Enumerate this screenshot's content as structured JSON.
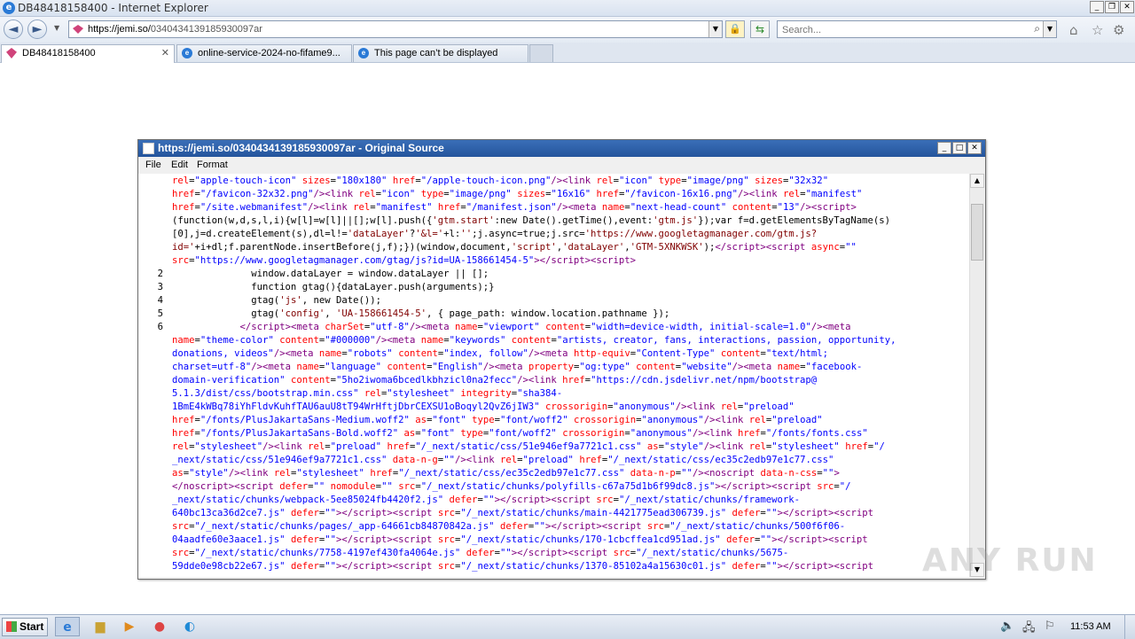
{
  "browser": {
    "window_title": "DB48418158400 - Internet Explorer",
    "address": {
      "host": "https://jemi.so/",
      "path": "0340434139185930097ar"
    },
    "search_placeholder": "Search..."
  },
  "tabs": [
    {
      "label": "DB48418158400",
      "icon": "gem-icon",
      "active": true
    },
    {
      "label": "online-service-2024-no-fifame9...",
      "icon": "ie-icon",
      "active": false
    },
    {
      "label": "This page can’t be displayed",
      "icon": "ie-icon",
      "active": false
    }
  ],
  "source_window": {
    "title": "https://jemi.so/0340434139185930097ar - Original Source",
    "menu": [
      "File",
      "Edit",
      "Format"
    ]
  },
  "code_lines": [
    {
      "n": "",
      "html": "<span class=\"at\">rel</span>=<span class=\"vl\">\"apple-touch-icon\"</span> <span class=\"at\">sizes</span>=<span class=\"vl\">\"180x180\"</span> <span class=\"at\">href</span>=<span class=\"vl\">\"/apple-touch-icon.png\"</span><span class=\"tg\">/&gt;&lt;link</span> <span class=\"at\">rel</span>=<span class=\"vl\">\"icon\"</span> <span class=\"at\">type</span>=<span class=\"vl\">\"image/png\"</span> <span class=\"at\">sizes</span>=<span class=\"vl\">\"32x32\"</span>"
    },
    {
      "n": "",
      "html": "<span class=\"at\">href</span>=<span class=\"vl\">\"/favicon-32x32.png\"</span><span class=\"tg\">/&gt;&lt;link</span> <span class=\"at\">rel</span>=<span class=\"vl\">\"icon\"</span> <span class=\"at\">type</span>=<span class=\"vl\">\"image/png\"</span> <span class=\"at\">sizes</span>=<span class=\"vl\">\"16x16\"</span> <span class=\"at\">href</span>=<span class=\"vl\">\"/favicon-16x16.png\"</span><span class=\"tg\">/&gt;&lt;link</span> <span class=\"at\">rel</span>=<span class=\"vl\">\"manifest\"</span>"
    },
    {
      "n": "",
      "html": "<span class=\"at\">href</span>=<span class=\"vl\">\"/site.webmanifest\"</span><span class=\"tg\">/&gt;&lt;link</span> <span class=\"at\">rel</span>=<span class=\"vl\">\"manifest\"</span> <span class=\"at\">href</span>=<span class=\"vl\">\"/manifest.json\"</span><span class=\"tg\">/&gt;&lt;meta</span> <span class=\"at\">name</span>=<span class=\"vl\">\"next-head-count\"</span> <span class=\"at\">content</span>=<span class=\"vl\">\"13\"</span><span class=\"tg\">/&gt;&lt;script&gt;</span>"
    },
    {
      "n": "",
      "html": "(function(w,d,s,l,i){w[l]=w[l]||[];w[l].push({<span class=\"st\">'gtm.start'</span>:new Date().getTime(),event:<span class=\"st\">'gtm.js'</span>});var f=d.getElementsByTagName(s)"
    },
    {
      "n": "",
      "html": "[0],j=d.createElement(s),dl=l!=<span class=\"st\">'dataLayer'</span>?<span class=\"st\">'&amp;l='</span>+l:<span class=\"st\">''</span>;j.async=true;j.src=<span class=\"st\">'https://www.googletagmanager.com/gtm.js?</span>"
    },
    {
      "n": "",
      "html": "<span class=\"st\">id='</span>+i+dl;f.parentNode.insertBefore(j,f);})(window,document,<span class=\"st\">'script'</span>,<span class=\"st\">'dataLayer'</span>,<span class=\"st\">'GTM-5XNKWSK'</span>);<span class=\"tg\">&lt;/script&gt;&lt;script</span> <span class=\"at\">async</span>=<span class=\"vl\">\"\"</span>"
    },
    {
      "n": "",
      "html": "<span class=\"at\">src</span>=<span class=\"vl\">\"https://www.googletagmanager.com/gtag/js?id=UA-158661454-5\"</span><span class=\"tg\">&gt;&lt;/script&gt;&lt;script&gt;</span>"
    },
    {
      "n": "2",
      "html": "              window.dataLayer = window.dataLayer || [];"
    },
    {
      "n": "3",
      "html": "              function gtag(){dataLayer.push(arguments);}"
    },
    {
      "n": "4",
      "html": "              gtag(<span class=\"st\">'js'</span>, new Date());"
    },
    {
      "n": "5",
      "html": "              gtag(<span class=\"st\">'config'</span>, <span class=\"st\">'UA-158661454-5'</span>, { page_path: window.location.pathname });"
    },
    {
      "n": "6",
      "html": "            <span class=\"tg\">&lt;/script&gt;&lt;meta</span> <span class=\"at\">charSet</span>=<span class=\"vl\">\"utf-8\"</span><span class=\"tg\">/&gt;&lt;meta</span> <span class=\"at\">name</span>=<span class=\"vl\">\"viewport\"</span> <span class=\"at\">content</span>=<span class=\"vl\">\"width=device-width, initial-scale=1.0\"</span><span class=\"tg\">/&gt;&lt;meta</span>"
    },
    {
      "n": "",
      "html": "<span class=\"at\">name</span>=<span class=\"vl\">\"theme-color\"</span> <span class=\"at\">content</span>=<span class=\"vl\">\"#000000\"</span><span class=\"tg\">/&gt;&lt;meta</span> <span class=\"at\">name</span>=<span class=\"vl\">\"keywords\"</span> <span class=\"at\">content</span>=<span class=\"vl\">\"artists, creator, fans, interactions, passion, opportunity,</span>"
    },
    {
      "n": "",
      "html": "<span class=\"vl\">donations, videos\"</span><span class=\"tg\">/&gt;&lt;meta</span> <span class=\"at\">name</span>=<span class=\"vl\">\"robots\"</span> <span class=\"at\">content</span>=<span class=\"vl\">\"index, follow\"</span><span class=\"tg\">/&gt;&lt;meta</span> <span class=\"at\">http-equiv</span>=<span class=\"vl\">\"Content-Type\"</span> <span class=\"at\">content</span>=<span class=\"vl\">\"text/html;</span>"
    },
    {
      "n": "",
      "html": "<span class=\"vl\">charset=utf-8\"</span><span class=\"tg\">/&gt;&lt;meta</span> <span class=\"at\">name</span>=<span class=\"vl\">\"language\"</span> <span class=\"at\">content</span>=<span class=\"vl\">\"English\"</span><span class=\"tg\">/&gt;&lt;meta</span> <span class=\"at\">property</span>=<span class=\"vl\">\"og:type\"</span> <span class=\"at\">content</span>=<span class=\"vl\">\"website\"</span><span class=\"tg\">/&gt;&lt;meta</span> <span class=\"at\">name</span>=<span class=\"vl\">\"facebook-</span>"
    },
    {
      "n": "",
      "html": "<span class=\"vl\">domain-verification\"</span> <span class=\"at\">content</span>=<span class=\"vl\">\"5ho2iwoma6bcedlkbhzicl0na2fecc\"</span><span class=\"tg\">/&gt;&lt;link</span> <span class=\"at\">href</span>=<span class=\"vl\">\"https://cdn.jsdelivr.net/npm/bootstrap@</span>"
    },
    {
      "n": "",
      "html": "<span class=\"vl\">5.1.3/dist/css/bootstrap.min.css\"</span> <span class=\"at\">rel</span>=<span class=\"vl\">\"stylesheet\"</span> <span class=\"at\">integrity</span>=<span class=\"vl\">\"sha384-</span>"
    },
    {
      "n": "",
      "html": "<span class=\"vl\">1BmE4kWBq78iYhFldvKuhfTAU6auU8tT94WrHftjDbrCEXSU1oBoqyl2QvZ6jIW3\"</span> <span class=\"at\">crossorigin</span>=<span class=\"vl\">\"anonymous\"</span><span class=\"tg\">/&gt;&lt;link</span> <span class=\"at\">rel</span>=<span class=\"vl\">\"preload\"</span>"
    },
    {
      "n": "",
      "html": "<span class=\"at\">href</span>=<span class=\"vl\">\"/fonts/PlusJakartaSans-Medium.woff2\"</span> <span class=\"at\">as</span>=<span class=\"vl\">\"font\"</span> <span class=\"at\">type</span>=<span class=\"vl\">\"font/woff2\"</span> <span class=\"at\">crossorigin</span>=<span class=\"vl\">\"anonymous\"</span><span class=\"tg\">/&gt;&lt;link</span> <span class=\"at\">rel</span>=<span class=\"vl\">\"preload\"</span>"
    },
    {
      "n": "",
      "html": "<span class=\"at\">href</span>=<span class=\"vl\">\"/fonts/PlusJakartaSans-Bold.woff2\"</span> <span class=\"at\">as</span>=<span class=\"vl\">\"font\"</span> <span class=\"at\">type</span>=<span class=\"vl\">\"font/woff2\"</span> <span class=\"at\">crossorigin</span>=<span class=\"vl\">\"anonymous\"</span><span class=\"tg\">/&gt;&lt;link</span> <span class=\"at\">href</span>=<span class=\"vl\">\"/fonts/fonts.css\"</span>"
    },
    {
      "n": "",
      "html": "<span class=\"at\">rel</span>=<span class=\"vl\">\"stylesheet\"</span><span class=\"tg\">/&gt;&lt;link</span> <span class=\"at\">rel</span>=<span class=\"vl\">\"preload\"</span> <span class=\"at\">href</span>=<span class=\"vl\">\"/_next/static/css/51e946ef9a7721c1.css\"</span> <span class=\"at\">as</span>=<span class=\"vl\">\"style\"</span><span class=\"tg\">/&gt;&lt;link</span> <span class=\"at\">rel</span>=<span class=\"vl\">\"stylesheet\"</span> <span class=\"at\">href</span>=<span class=\"vl\">\"/</span>"
    },
    {
      "n": "",
      "html": "<span class=\"vl\">_next/static/css/51e946ef9a7721c1.css\"</span> <span class=\"at\">data-n-g</span>=<span class=\"vl\">\"\"</span><span class=\"tg\">/&gt;&lt;link</span> <span class=\"at\">rel</span>=<span class=\"vl\">\"preload\"</span> <span class=\"at\">href</span>=<span class=\"vl\">\"/_next/static/css/ec35c2edb97e1c77.css\"</span>"
    },
    {
      "n": "",
      "html": "<span class=\"at\">as</span>=<span class=\"vl\">\"style\"</span><span class=\"tg\">/&gt;&lt;link</span> <span class=\"at\">rel</span>=<span class=\"vl\">\"stylesheet\"</span> <span class=\"at\">href</span>=<span class=\"vl\">\"/_next/static/css/ec35c2edb97e1c77.css\"</span> <span class=\"at\">data-n-p</span>=<span class=\"vl\">\"\"</span><span class=\"tg\">/&gt;&lt;noscript</span> <span class=\"at\">data-n-css</span>=<span class=\"vl\">\"\"</span><span class=\"tg\">&gt;</span>"
    },
    {
      "n": "",
      "html": "<span class=\"tg\">&lt;/noscript&gt;&lt;script</span> <span class=\"at\">defer</span>=<span class=\"vl\">\"\"</span> <span class=\"at\">nomodule</span>=<span class=\"vl\">\"\"</span> <span class=\"at\">src</span>=<span class=\"vl\">\"/_next/static/chunks/polyfills-c67a75d1b6f99dc8.js\"</span><span class=\"tg\">&gt;&lt;/script&gt;&lt;script</span> <span class=\"at\">src</span>=<span class=\"vl\">\"/</span>"
    },
    {
      "n": "",
      "html": "<span class=\"vl\">_next/static/chunks/webpack-5ee85024fb4420f2.js\"</span> <span class=\"at\">defer</span>=<span class=\"vl\">\"\"</span><span class=\"tg\">&gt;&lt;/script&gt;&lt;script</span> <span class=\"at\">src</span>=<span class=\"vl\">\"/_next/static/chunks/framework-</span>"
    },
    {
      "n": "",
      "html": "<span class=\"vl\">640bc13ca36d2ce7.js\"</span> <span class=\"at\">defer</span>=<span class=\"vl\">\"\"</span><span class=\"tg\">&gt;&lt;/script&gt;&lt;script</span> <span class=\"at\">src</span>=<span class=\"vl\">\"/_next/static/chunks/main-4421775ead306739.js\"</span> <span class=\"at\">defer</span>=<span class=\"vl\">\"\"</span><span class=\"tg\">&gt;&lt;/script&gt;&lt;script</span>"
    },
    {
      "n": "",
      "html": "<span class=\"at\">src</span>=<span class=\"vl\">\"/_next/static/chunks/pages/_app-64661cb84870842a.js\"</span> <span class=\"at\">defer</span>=<span class=\"vl\">\"\"</span><span class=\"tg\">&gt;&lt;/script&gt;&lt;script</span> <span class=\"at\">src</span>=<span class=\"vl\">\"/_next/static/chunks/500f6f06-</span>"
    },
    {
      "n": "",
      "html": "<span class=\"vl\">04aadfe60e3aace1.js\"</span> <span class=\"at\">defer</span>=<span class=\"vl\">\"\"</span><span class=\"tg\">&gt;&lt;/script&gt;&lt;script</span> <span class=\"at\">src</span>=<span class=\"vl\">\"/_next/static/chunks/170-1cbcffea1cd951ad.js\"</span> <span class=\"at\">defer</span>=<span class=\"vl\">\"\"</span><span class=\"tg\">&gt;&lt;/script&gt;&lt;script</span>"
    },
    {
      "n": "",
      "html": "<span class=\"at\">src</span>=<span class=\"vl\">\"/_next/static/chunks/7758-4197ef430fa4064e.js\"</span> <span class=\"at\">defer</span>=<span class=\"vl\">\"\"</span><span class=\"tg\">&gt;&lt;/script&gt;&lt;script</span> <span class=\"at\">src</span>=<span class=\"vl\">\"/_next/static/chunks/5675-</span>"
    },
    {
      "n": "",
      "html": "<span class=\"vl\">59dde0e98cb22e67.js\"</span> <span class=\"at\">defer</span>=<span class=\"vl\">\"\"</span><span class=\"tg\">&gt;&lt;/script&gt;&lt;script</span> <span class=\"at\">src</span>=<span class=\"vl\">\"/_next/static/chunks/1370-85102a4a15630c01.js\"</span> <span class=\"at\">defer</span>=<span class=\"vl\">\"\"</span><span class=\"tg\">&gt;&lt;/script&gt;&lt;script</span>"
    }
  ],
  "watermark": "ANY RUN",
  "taskbar": {
    "start_label": "Start",
    "clock": "11:53 AM",
    "apps": [
      "ie-icon",
      "explorer-icon",
      "media-player-icon",
      "chrome-icon",
      "edge-icon"
    ]
  }
}
